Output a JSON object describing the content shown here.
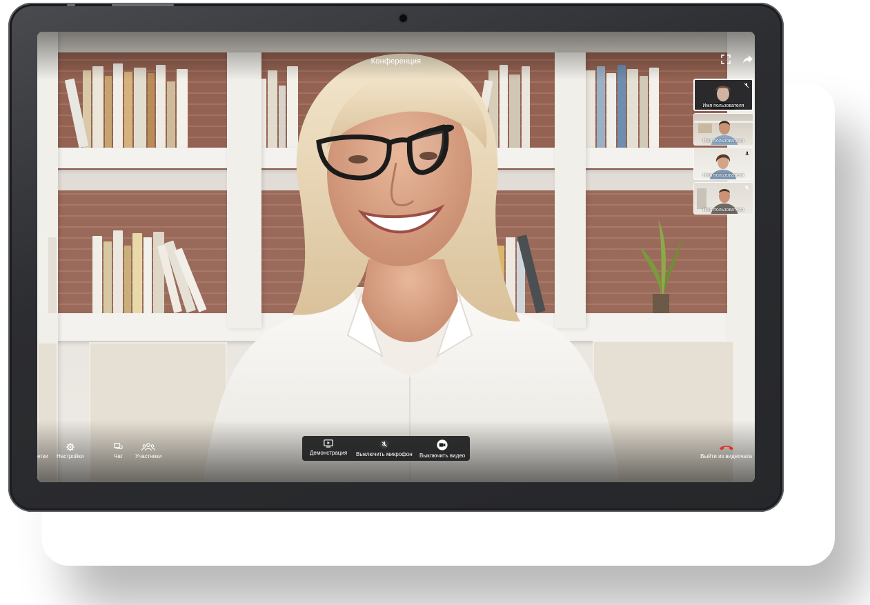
{
  "header": {
    "title": "Конференция"
  },
  "participants": [
    {
      "name": "Имя пользователя",
      "mic_state": "muted",
      "active": true
    },
    {
      "name": "Имя пользователя",
      "mic_state": "none",
      "active": false
    },
    {
      "name": "Имя пользователя",
      "mic_state": "on",
      "active": false
    },
    {
      "name": "Имя пользователя",
      "mic_state": "muted",
      "active": false
    }
  ],
  "toolbar": {
    "left": {
      "grid_label": "етки",
      "settings_label": "Настройки",
      "chat_label": "Чат",
      "participants_label": "Участники"
    },
    "center": {
      "screen_share_label": "Демонстрация",
      "mute_label": "Выключить микрофон",
      "video_label": "Выключить видео"
    },
    "right": {
      "leave_label": "Выйти из видеочата"
    }
  },
  "icons": {
    "fullscreen": "fullscreen-icon",
    "share": "share-arrow-icon",
    "settings": "gear-icon",
    "chat": "chat-bubbles-icon",
    "participants": "people-icon",
    "screen_share": "screen-play-icon",
    "mic_off": "mic-off-icon",
    "video": "video-camera-icon",
    "hang_up": "phone-hangup-icon"
  },
  "colors": {
    "hang_up": "#e0302a",
    "toolbar_bg": "#1e1e20",
    "text": "#ffffff"
  }
}
